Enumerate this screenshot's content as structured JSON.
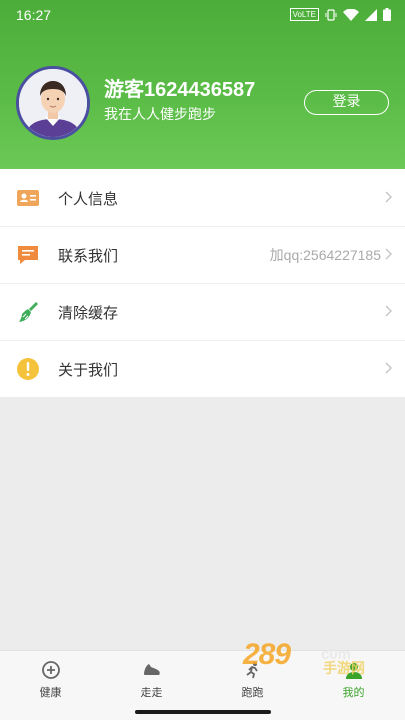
{
  "status_bar": {
    "time": "16:27",
    "network": "VoLTE"
  },
  "profile": {
    "username": "游客1624436587",
    "subtitle": "我在人人健步跑步",
    "login_label": "登录"
  },
  "menu": {
    "items": [
      {
        "label": "个人信息",
        "value": "",
        "icon": "id-card-icon",
        "color": "#f0a65a"
      },
      {
        "label": "联系我们",
        "value": "加qq:2564227185",
        "icon": "chat-bubble-icon",
        "color": "#f08a3c"
      },
      {
        "label": "清除缓存",
        "value": "",
        "icon": "broom-icon",
        "color": "#3fae5a"
      },
      {
        "label": "关于我们",
        "value": "",
        "icon": "info-exclamation-icon",
        "color": "#f5c33b"
      }
    ]
  },
  "tabs": [
    {
      "label": "健康",
      "icon": "health-plus-icon",
      "active": false
    },
    {
      "label": "走走",
      "icon": "shoe-icon",
      "active": false
    },
    {
      "label": "跑跑",
      "icon": "run-icon",
      "active": false
    },
    {
      "label": "我的",
      "icon": "profile-icon",
      "active": true
    }
  ],
  "watermark": {
    "text": "289",
    "sub": "c0m",
    "cn": "手游网"
  },
  "colors": {
    "header": "#5bbd47",
    "active_tab": "#3aa32a"
  }
}
